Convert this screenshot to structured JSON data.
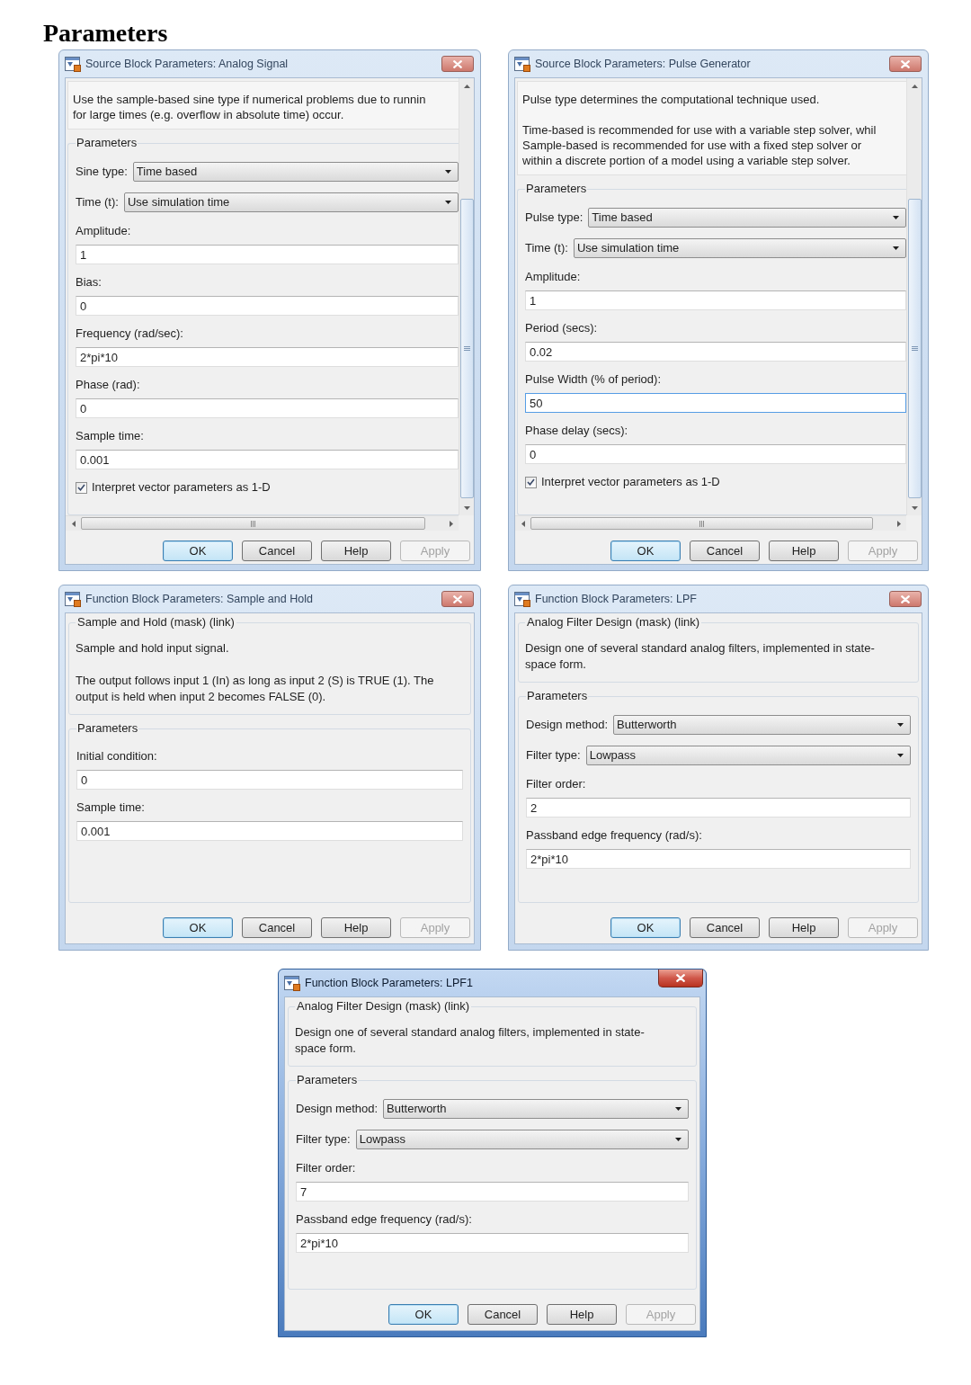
{
  "heading": "Parameters",
  "dialogs": [
    {
      "title": "Source Block Parameters: Analog Signal",
      "active": false,
      "scrollbars": true,
      "description": [
        "Use the sample-based sine type if numerical problems due to runnin\nfor large times (e.g. overflow in absolute time) occur."
      ],
      "group": "Parameters",
      "fields": [
        {
          "kind": "dropdown",
          "label": "Sine type:",
          "value": "Time based"
        },
        {
          "kind": "dropdown",
          "label": "Time (t):",
          "value": "Use simulation time"
        },
        {
          "kind": "text",
          "label": "Amplitude:",
          "value": "1",
          "focused": false
        },
        {
          "kind": "text",
          "label": "Bias:",
          "value": "0",
          "focused": false
        },
        {
          "kind": "text",
          "label": "Frequency (rad/sec):",
          "value": "2*pi*10",
          "focused": false
        },
        {
          "kind": "text",
          "label": "Phase (rad):",
          "value": "0",
          "focused": false
        },
        {
          "kind": "text",
          "label": "Sample time:",
          "value": "0.001",
          "focused": false
        },
        {
          "kind": "checkbox",
          "label": "Interpret vector parameters as 1-D",
          "checked": true
        }
      ],
      "buttons": [
        {
          "label": "OK",
          "default": true,
          "disabled": false
        },
        {
          "label": "Cancel",
          "default": false,
          "disabled": false
        },
        {
          "label": "Help",
          "default": false,
          "disabled": false
        },
        {
          "label": "Apply",
          "default": false,
          "disabled": true
        }
      ]
    },
    {
      "title": "Source Block Parameters: Pulse Generator",
      "active": false,
      "scrollbars": true,
      "description": [
        "Pulse type determines the computational technique used.",
        "Time-based is recommended for use with a variable step solver, whil\nSample-based is recommended for use with a fixed step solver or\nwithin a discrete portion of a model using a variable step solver."
      ],
      "group": "Parameters",
      "fields": [
        {
          "kind": "dropdown",
          "label": "Pulse type:",
          "value": "Time based"
        },
        {
          "kind": "dropdown",
          "label": "Time (t):",
          "value": "Use simulation time"
        },
        {
          "kind": "text",
          "label": "Amplitude:",
          "value": "1",
          "focused": false
        },
        {
          "kind": "text",
          "label": "Period (secs):",
          "value": "0.02",
          "focused": false
        },
        {
          "kind": "text",
          "label": "Pulse Width (% of period):",
          "value": "50",
          "focused": true
        },
        {
          "kind": "text",
          "label": "Phase delay (secs):",
          "value": "0",
          "focused": false
        },
        {
          "kind": "checkbox",
          "label": "Interpret vector parameters as 1-D",
          "checked": true
        }
      ],
      "buttons": [
        {
          "label": "OK",
          "default": true,
          "disabled": false
        },
        {
          "label": "Cancel",
          "default": false,
          "disabled": false
        },
        {
          "label": "Help",
          "default": false,
          "disabled": false
        },
        {
          "label": "Apply",
          "default": false,
          "disabled": true
        }
      ]
    },
    {
      "title": "Function Block Parameters: Sample and Hold",
      "active": false,
      "scrollbars": false,
      "mask_title": "Sample and Hold (mask) (link)",
      "description": [
        "Sample and hold input signal.",
        "The output follows input 1 (In) as long as input 2 (S) is TRUE (1). The\noutput is held when input 2 becomes FALSE (0)."
      ],
      "group": "Parameters",
      "fields": [
        {
          "kind": "text",
          "label": "Initial condition:",
          "value": "0",
          "focused": false
        },
        {
          "kind": "text",
          "label": "Sample time:",
          "value": "0.001",
          "focused": false
        }
      ],
      "buttons": [
        {
          "label": "OK",
          "default": true,
          "disabled": false
        },
        {
          "label": "Cancel",
          "default": false,
          "disabled": false
        },
        {
          "label": "Help",
          "default": false,
          "disabled": false
        },
        {
          "label": "Apply",
          "default": false,
          "disabled": true
        }
      ]
    },
    {
      "title": "Function Block Parameters: LPF",
      "active": false,
      "scrollbars": false,
      "mask_title": "Analog Filter Design (mask) (link)",
      "description": [
        "Design one of several standard analog filters, implemented in state-\nspace form."
      ],
      "group": "Parameters",
      "fields": [
        {
          "kind": "dropdown",
          "label": "Design method:",
          "value": "Butterworth"
        },
        {
          "kind": "dropdown",
          "label": "Filter type:",
          "value": "Lowpass"
        },
        {
          "kind": "text",
          "label": "Filter order:",
          "value": "2",
          "focused": false
        },
        {
          "kind": "text",
          "label": "Passband edge frequency (rad/s):",
          "value": "2*pi*10",
          "focused": false
        }
      ],
      "buttons": [
        {
          "label": "OK",
          "default": true,
          "disabled": false
        },
        {
          "label": "Cancel",
          "default": false,
          "disabled": false
        },
        {
          "label": "Help",
          "default": false,
          "disabled": false
        },
        {
          "label": "Apply",
          "default": false,
          "disabled": true
        }
      ]
    },
    {
      "title": "Function Block Parameters: LPF1",
      "active": true,
      "scrollbars": false,
      "mask_title": "Analog Filter Design (mask) (link)",
      "description": [
        "Design one of several standard analog filters, implemented in state-\nspace form."
      ],
      "group": "Parameters",
      "fields": [
        {
          "kind": "dropdown",
          "label": "Design method:",
          "value": "Butterworth"
        },
        {
          "kind": "dropdown",
          "label": "Filter type:",
          "value": "Lowpass"
        },
        {
          "kind": "text",
          "label": "Filter order:",
          "value": "7",
          "focused": false
        },
        {
          "kind": "text",
          "label": "Passband edge frequency (rad/s):",
          "value": "2*pi*10",
          "focused": false
        }
      ],
      "buttons": [
        {
          "label": "OK",
          "default": true,
          "disabled": false
        },
        {
          "label": "Cancel",
          "default": false,
          "disabled": false
        },
        {
          "label": "Help",
          "default": false,
          "disabled": false
        },
        {
          "label": "Apply",
          "default": false,
          "disabled": true
        }
      ]
    }
  ]
}
